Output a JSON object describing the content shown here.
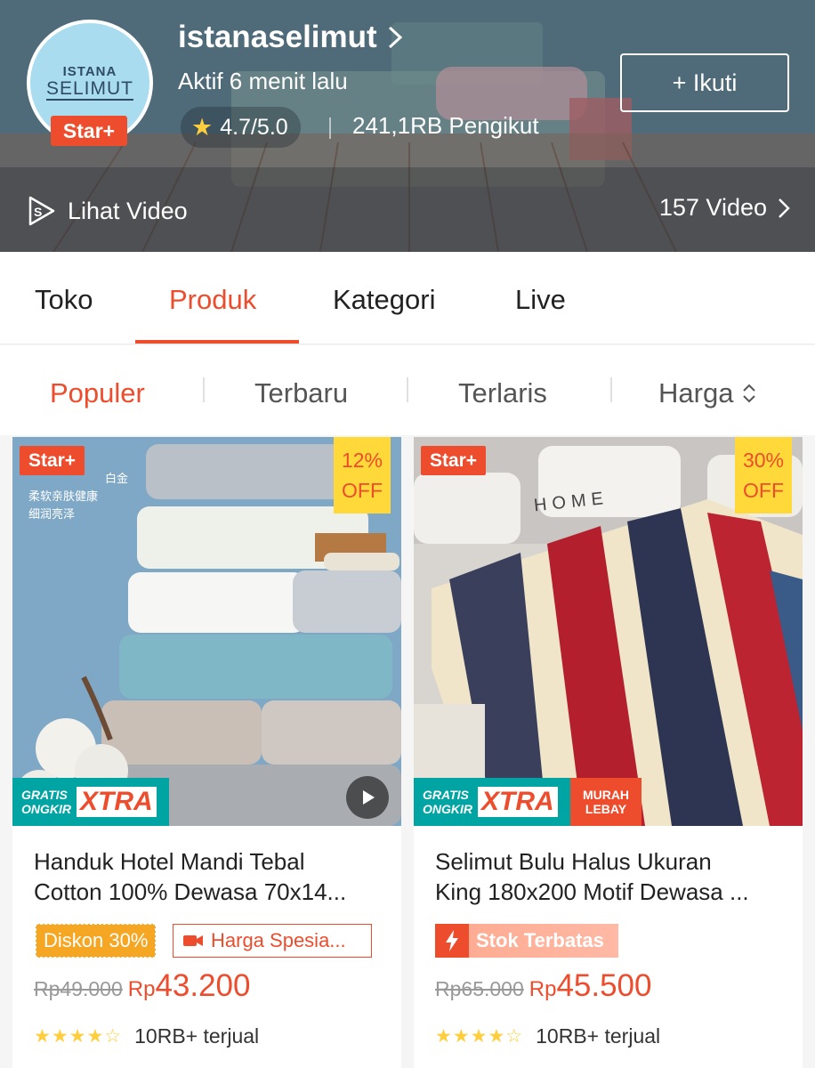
{
  "shop": {
    "logo_line1": "ISTANA",
    "logo_line2": "SELIMUT",
    "badge": "Star+",
    "name": "istanaselimut",
    "active_status": "Aktif 6 menit lalu",
    "rating": "4.7/5.0",
    "followers": "241,1RB Pengikut",
    "follow_label": "+ Ikuti",
    "video_link_label": "Lihat Video",
    "video_count": "157 Video"
  },
  "tabs": [
    {
      "label": "Toko"
    },
    {
      "label": "Produk"
    },
    {
      "label": "Kategori"
    },
    {
      "label": "Live"
    }
  ],
  "active_tab": "Produk",
  "sort": [
    {
      "label": "Populer"
    },
    {
      "label": "Terbaru"
    },
    {
      "label": "Terlaris"
    },
    {
      "label": "Harga"
    }
  ],
  "products": [
    {
      "badge": "Star+",
      "discount_pct": "12%",
      "discount_word": "OFF",
      "image_text": [
        "白金",
        "柔软亲肤健康",
        "细润亮泽"
      ],
      "gratis_line1": "GRATIS",
      "gratis_line2": "ONGKIR",
      "gratis_xtra": "XTRA",
      "title_line1": "Handuk Hotel Mandi Tebal",
      "title_line2": "Cotton 100% Dewasa 70x14...",
      "promo_tag": "Diskon 30%",
      "special_tag": "Harga Spesia...",
      "old_price": "Rp49.000",
      "currency": "Rp",
      "price": "43.200",
      "rating_value": 4.5,
      "sold": "10RB+ terjual"
    },
    {
      "badge": "Star+",
      "discount_pct": "30%",
      "discount_word": "OFF",
      "pillow_text": "HOME",
      "gratis_line1": "GRATIS",
      "gratis_line2": "ONGKIR",
      "gratis_xtra": "XTRA",
      "murah_line1": "MURAH",
      "murah_line2": "LEBAY",
      "title_line1": "Selimut Bulu Halus Ukuran",
      "title_line2": "King 180x200 Motif Dewasa ...",
      "promo_tag": "Stok Terbatas",
      "old_price": "Rp65.000",
      "currency": "Rp",
      "price": "45.500",
      "rating_value": 4.5,
      "sold": "10RB+ terjual"
    }
  ],
  "colors": {
    "accent": "#ee4d2d",
    "star": "#ffce3d",
    "discount_bg": "#ffd839",
    "gratis_bg": "#00a5a3"
  }
}
